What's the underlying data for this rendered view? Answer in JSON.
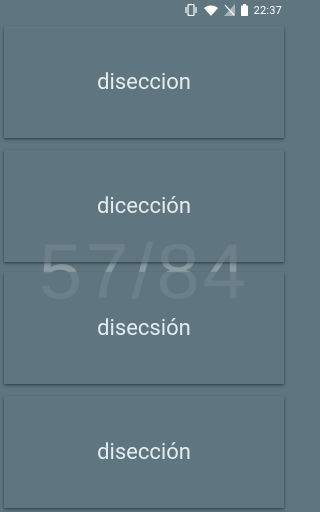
{
  "status_bar": {
    "time": "22:37",
    "icons": [
      "vibrate-icon",
      "wifi-icon",
      "signal-off-icon",
      "battery-icon"
    ]
  },
  "counter": {
    "text": "57/84"
  },
  "options": [
    {
      "label": "diseccion"
    },
    {
      "label": "dicección"
    },
    {
      "label": "disecsión"
    },
    {
      "label": "disección"
    }
  ],
  "colors": {
    "background": "#5f7680",
    "text": "#e4ecef"
  }
}
